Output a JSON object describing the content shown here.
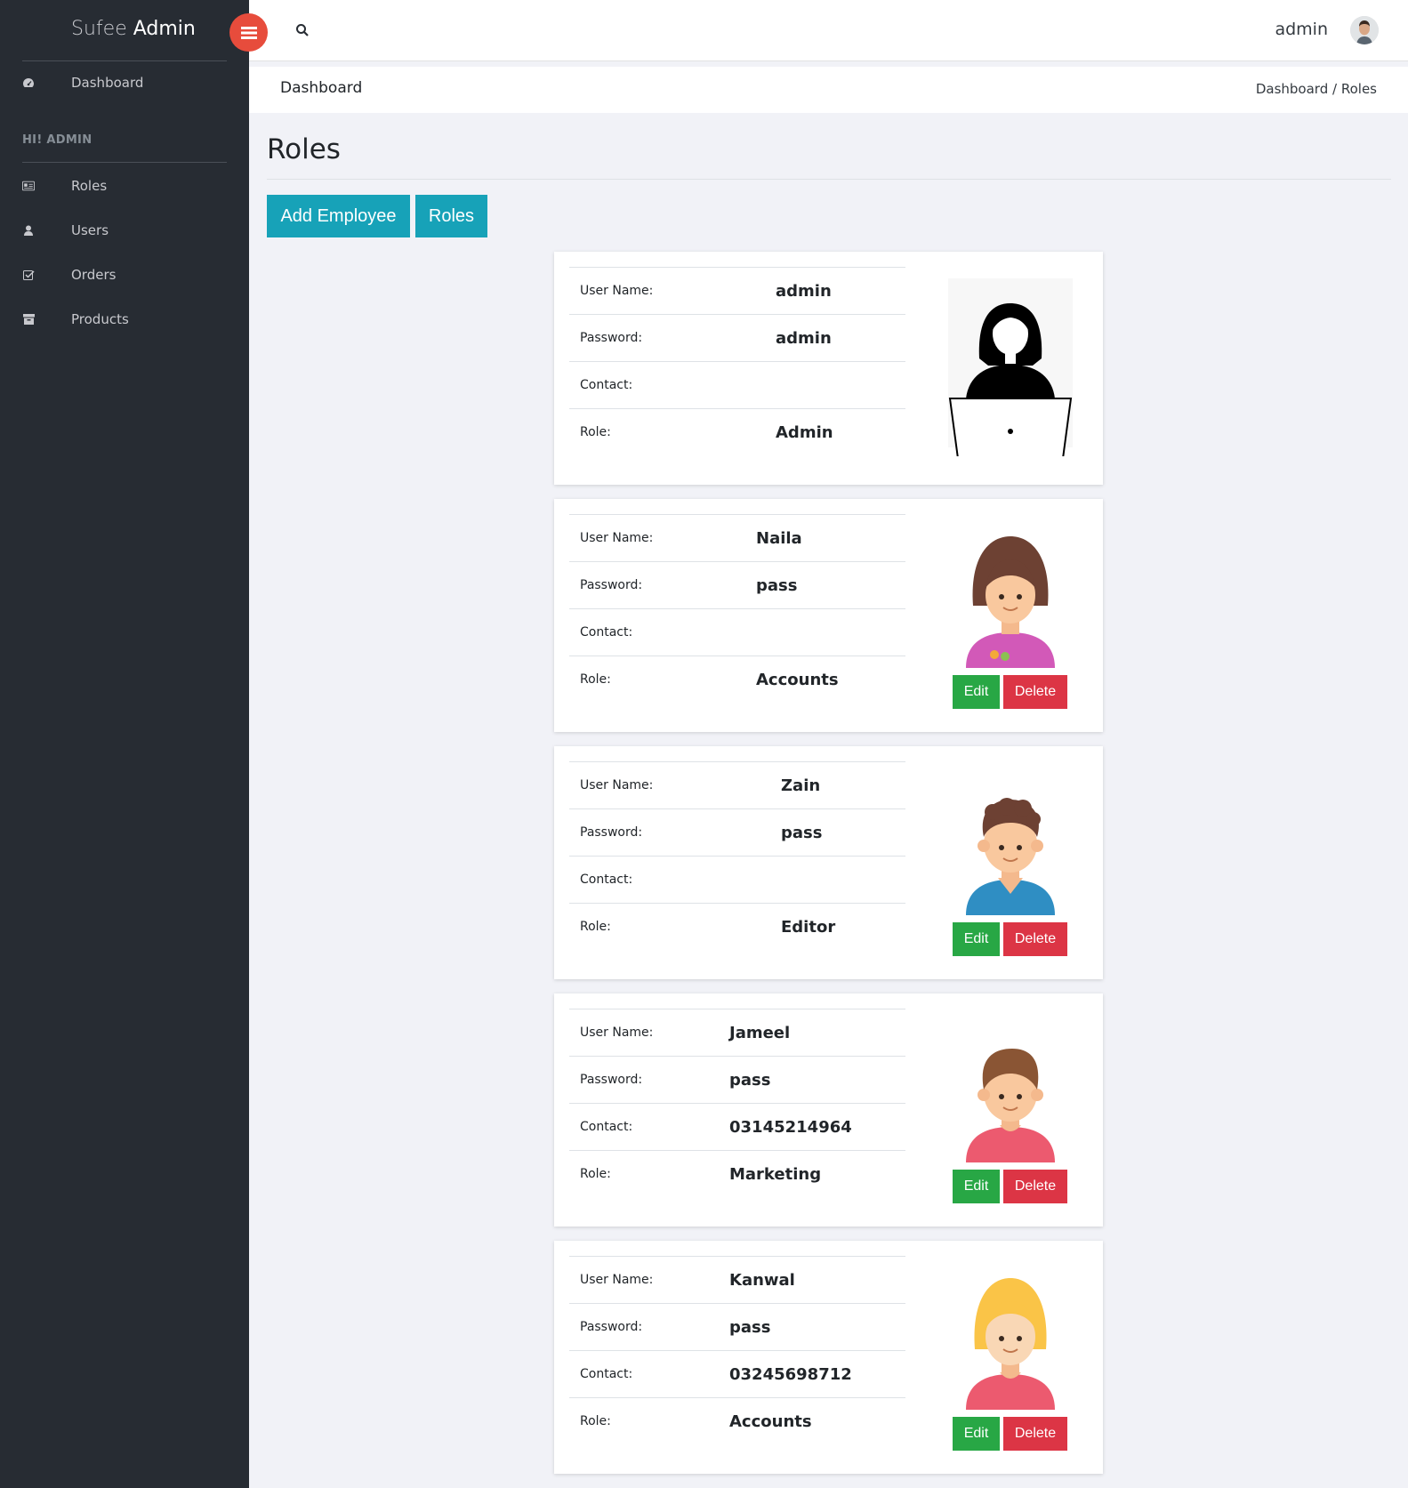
{
  "brand": {
    "light": "Sufee",
    "bold": "Admin"
  },
  "sidebar": {
    "top_item": {
      "label": "Dashboard",
      "icon": "dashboard-icon"
    },
    "heading": "HI! ADMIN",
    "items": [
      {
        "label": "Roles",
        "icon": "id-card-icon"
      },
      {
        "label": "Users",
        "icon": "user-icon"
      },
      {
        "label": "Orders",
        "icon": "check-square-icon"
      },
      {
        "label": "Products",
        "icon": "archive-icon"
      }
    ]
  },
  "header": {
    "user_name": "admin",
    "toggle_color": "#e74c3c"
  },
  "breadcrumb": {
    "title": "Dashboard",
    "trail": [
      "Dashboard",
      "Roles"
    ],
    "separator": "/"
  },
  "page": {
    "title": "Roles"
  },
  "actions": {
    "add_employee": "Add Employee",
    "roles": "Roles",
    "color": "#17a2b8"
  },
  "labels": {
    "username": "User Name:",
    "password": "Password:",
    "contact": "Contact:",
    "role": "Role:"
  },
  "buttons": {
    "edit": "Edit",
    "delete": "Delete",
    "edit_color": "#28a745",
    "delete_color": "#dc3545"
  },
  "employees": [
    {
      "username": "admin",
      "password": "admin",
      "contact": "",
      "role": "Admin",
      "avatar": "woman-laptop-icon"
    },
    {
      "username": "Naila",
      "password": "pass",
      "contact": "",
      "role": "Accounts",
      "avatar": "girl-brown-hair-icon"
    },
    {
      "username": "Zain",
      "password": "pass",
      "contact": "",
      "role": "Editor",
      "avatar": "boy-curly-hair-icon"
    },
    {
      "username": "Jameel",
      "password": "pass",
      "contact": "03145214964",
      "role": "Marketing",
      "avatar": "boy-red-shirt-icon"
    },
    {
      "username": "Kanwal",
      "password": "pass",
      "contact": "03245698712",
      "role": "Accounts",
      "avatar": "girl-blonde-hair-icon"
    }
  ]
}
